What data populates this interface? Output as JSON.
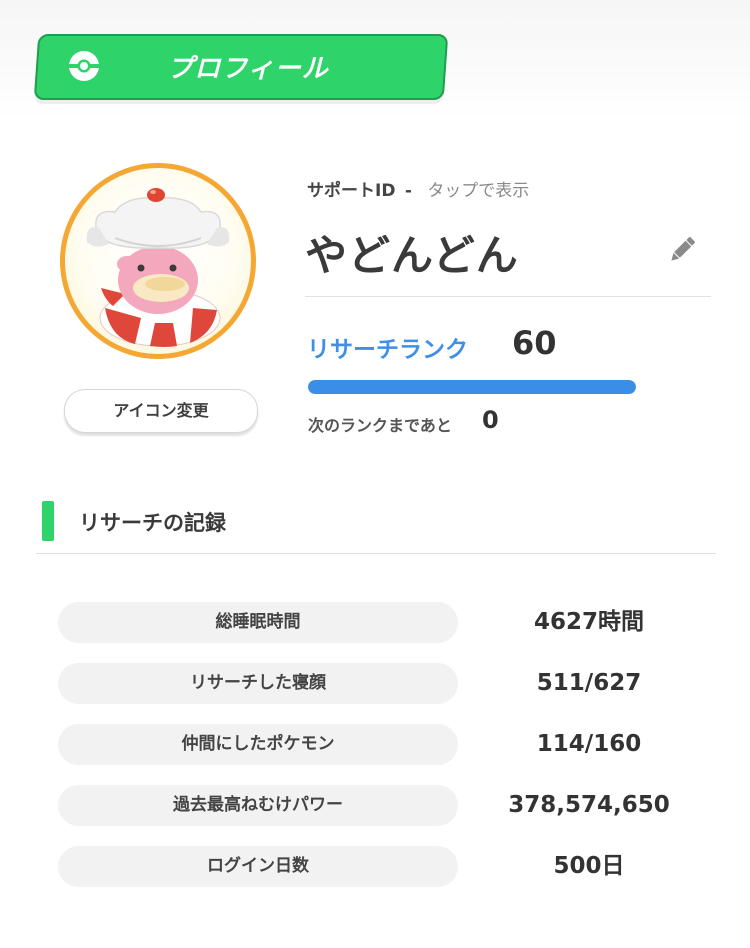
{
  "header": {
    "title": "プロフィール",
    "icon": "monster-ball-icon",
    "accent_color": "#2ed36a"
  },
  "profile": {
    "avatar": "slowpoke-avatar",
    "icon_change_label": "アイコン変更",
    "support_id_label": "サポートID",
    "support_id_separator": "-",
    "support_id_hint": "タップで表示",
    "name": "やどんどん",
    "edit_icon": "pencil-icon"
  },
  "rank": {
    "label": "リサーチランク",
    "value": "60",
    "progress": 1.0,
    "bar_color": "#3a8ee6",
    "next_label": "次のランクまであと",
    "next_value": "0"
  },
  "records": {
    "title": "リサーチの記録",
    "items": [
      {
        "label": "総睡眠時間",
        "value": "4627時間"
      },
      {
        "label": "リサーチした寝顔",
        "value": "511/627"
      },
      {
        "label": "仲間にしたポケモン",
        "value": "114/160"
      },
      {
        "label": "過去最高ねむけパワー",
        "value": "378,574,650"
      },
      {
        "label": "ログイン日数",
        "value": "500日"
      }
    ]
  }
}
